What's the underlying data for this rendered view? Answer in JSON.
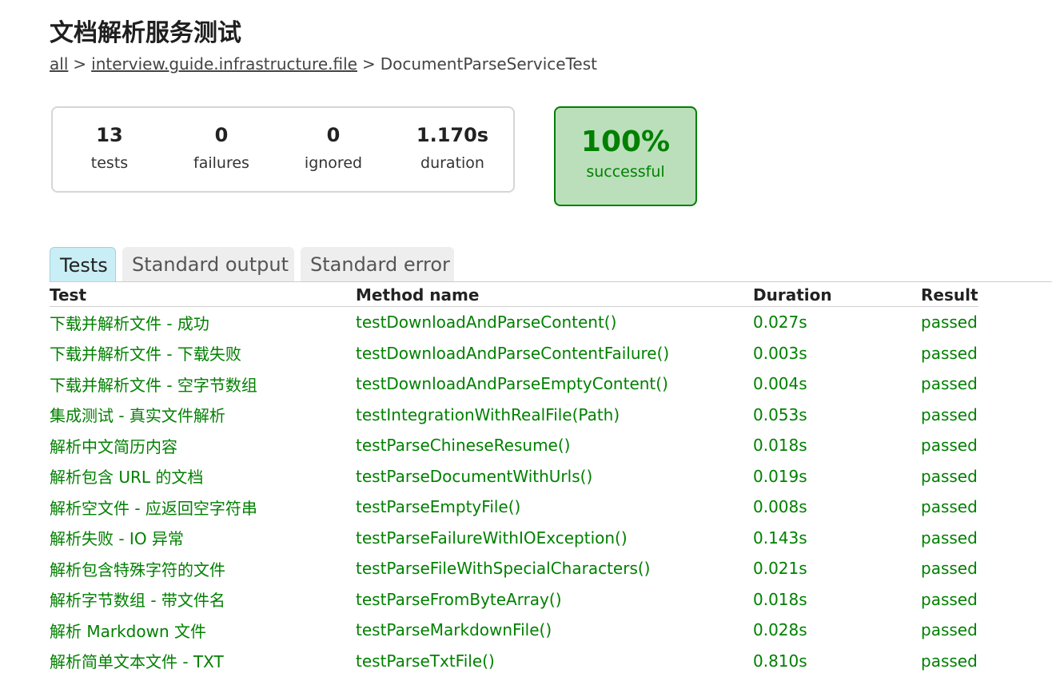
{
  "page_title": "文档解析服务测试",
  "breadcrumbs": {
    "items": [
      "all",
      "interview.guide.infrastructure.file"
    ],
    "current": "DocumentParseServiceTest",
    "separator": ">"
  },
  "summary": {
    "tests": {
      "value": "13",
      "label": "tests"
    },
    "failures": {
      "value": "0",
      "label": "failures"
    },
    "ignored": {
      "value": "0",
      "label": "ignored"
    },
    "duration": {
      "value": "1.170s",
      "label": "duration"
    }
  },
  "success_rate": {
    "value": "100%",
    "label": "successful"
  },
  "tabs": [
    {
      "label": "Tests",
      "selected": true
    },
    {
      "label": "Standard output",
      "selected": false
    },
    {
      "label": "Standard error",
      "selected": false
    }
  ],
  "table": {
    "headers": [
      "Test",
      "Method name",
      "Duration",
      "Result"
    ],
    "rows": [
      {
        "test": "下载并解析文件 - 成功",
        "method": "testDownloadAndParseContent()",
        "duration": "0.027s",
        "result": "passed"
      },
      {
        "test": "下载并解析文件 - 下载失败",
        "method": "testDownloadAndParseContentFailure()",
        "duration": "0.003s",
        "result": "passed"
      },
      {
        "test": "下载并解析文件 - 空字节数组",
        "method": "testDownloadAndParseEmptyContent()",
        "duration": "0.004s",
        "result": "passed"
      },
      {
        "test": "集成测试 - 真实文件解析",
        "method": "testIntegrationWithRealFile(Path)",
        "duration": "0.053s",
        "result": "passed"
      },
      {
        "test": "解析中文简历内容",
        "method": "testParseChineseResume()",
        "duration": "0.018s",
        "result": "passed"
      },
      {
        "test": "解析包含 URL 的文档",
        "method": "testParseDocumentWithUrls()",
        "duration": "0.019s",
        "result": "passed"
      },
      {
        "test": "解析空文件 - 应返回空字符串",
        "method": "testParseEmptyFile()",
        "duration": "0.008s",
        "result": "passed"
      },
      {
        "test": "解析失败 - IO 异常",
        "method": "testParseFailureWithIOException()",
        "duration": "0.143s",
        "result": "passed"
      },
      {
        "test": "解析包含特殊字符的文件",
        "method": "testParseFileWithSpecialCharacters()",
        "duration": "0.021s",
        "result": "passed"
      },
      {
        "test": "解析字节数组 - 带文件名",
        "method": "testParseFromByteArray()",
        "duration": "0.018s",
        "result": "passed"
      },
      {
        "test": "解析 Markdown 文件",
        "method": "testParseMarkdownFile()",
        "duration": "0.028s",
        "result": "passed"
      },
      {
        "test": "解析简单文本文件 - TXT",
        "method": "testParseTxtFile()",
        "duration": "0.810s",
        "result": "passed"
      }
    ]
  },
  "colors": {
    "success_green": "#008000",
    "success_bg": "#bbdfbb",
    "selected_tab_bg": "#c9eef5",
    "tab_bg": "#eeeeee"
  }
}
